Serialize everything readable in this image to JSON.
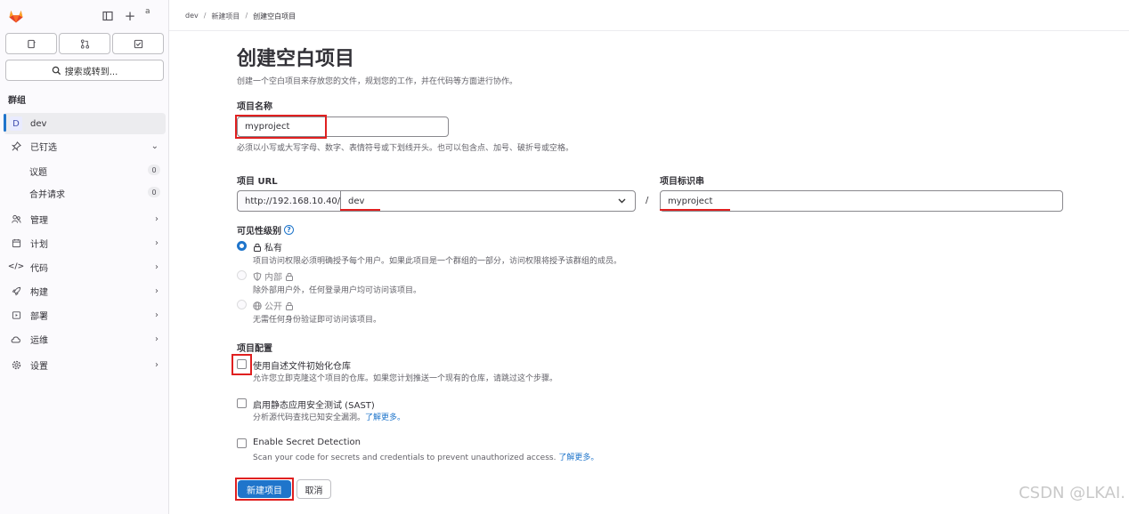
{
  "sidebar": {
    "avatar_alt": "a",
    "search_label": "搜索或转到...",
    "group_heading": "群组",
    "items": [
      {
        "label": "dev",
        "letter": "D"
      },
      {
        "label": "已钉选"
      },
      {
        "label": "议题",
        "count": "0"
      },
      {
        "label": "合并请求",
        "count": "0"
      },
      {
        "label": "管理"
      },
      {
        "label": "计划"
      },
      {
        "label": "代码"
      },
      {
        "label": "构建"
      },
      {
        "label": "部署"
      },
      {
        "label": "运维"
      },
      {
        "label": "设置"
      }
    ]
  },
  "breadcrumb": [
    "dev",
    "新建项目",
    "创建空白项目"
  ],
  "page": {
    "title": "创建空白项目",
    "description": "创建一个空白项目来存放您的文件，规划您的工作，并在代码等方面进行协作。"
  },
  "form": {
    "name_label": "项目名称",
    "name_value": "myproject",
    "name_help": "必须以小写或大写字母、数字、表情符号或下划线开头。也可以包含点、加号、破折号或空格。",
    "url_label": "项目 URL",
    "url_prefix": "http://192.168.10.40/",
    "namespace": "dev",
    "slug_label": "项目标识串",
    "slug_value": "myproject",
    "visibility_label": "可见性级别",
    "visibility_options": [
      {
        "label": "私有",
        "desc": "项目访问权限必须明确授予每个用户。如果此项目是一个群组的一部分，访问权限将授予该群组的成员。"
      },
      {
        "label": "内部",
        "desc": "除外部用户外，任何登录用户均可访问该项目。"
      },
      {
        "label": "公开",
        "desc": "无需任何身份验证即可访问该项目。"
      }
    ],
    "config_label": "项目配置",
    "config_options": [
      {
        "label": "使用自述文件初始化仓库",
        "desc": "允许您立即克隆这个项目的仓库。如果您计划推送一个现有的仓库，请跳过这个步骤。",
        "link": ""
      },
      {
        "label": "启用静态应用安全测试 (SAST)",
        "desc": "分析源代码查找已知安全漏洞。",
        "link": "了解更多。"
      },
      {
        "label": "Enable Secret Detection",
        "desc": "Scan your code for secrets and credentials to prevent unauthorized access.",
        "link": "了解更多。"
      }
    ],
    "submit_label": "新建项目",
    "cancel_label": "取消"
  },
  "watermark": "CSDN @LKAI.",
  "colors": {
    "accent": "#1f75cb",
    "annotation": "#e02020"
  }
}
